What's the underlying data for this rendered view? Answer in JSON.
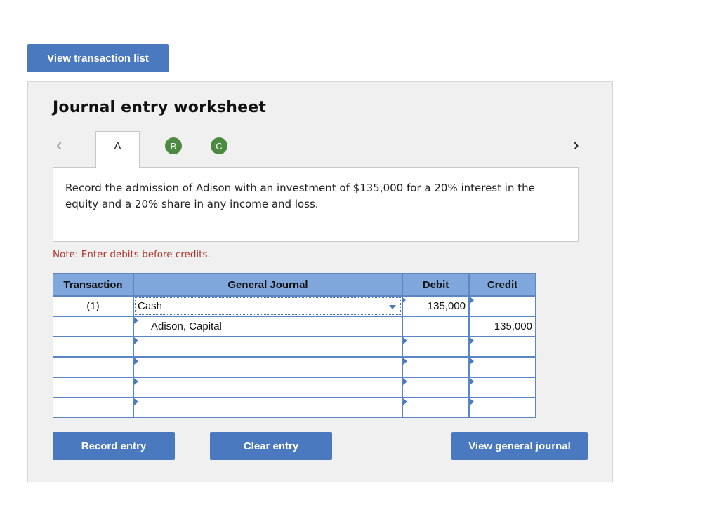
{
  "top_button": "View transaction list",
  "worksheet": {
    "title": "Journal entry worksheet",
    "tabs": [
      "A",
      "B",
      "C"
    ],
    "description": "Record the admission of Adison with an investment of $135,000 for a 20% interest in the equity and a 20% share in any income and loss.",
    "note": "Note: Enter debits before credits."
  },
  "journal": {
    "headers": {
      "transaction": "Transaction",
      "account": "General Journal",
      "debit": "Debit",
      "credit": "Credit"
    },
    "rows": [
      {
        "transaction": "(1)",
        "account": "Cash",
        "debit": "135,000",
        "credit": ""
      },
      {
        "transaction": "",
        "account": "Adison, Capital",
        "debit": "",
        "credit": "135,000"
      },
      {
        "transaction": "",
        "account": "",
        "debit": "",
        "credit": ""
      },
      {
        "transaction": "",
        "account": "",
        "debit": "",
        "credit": ""
      },
      {
        "transaction": "",
        "account": "",
        "debit": "",
        "credit": ""
      },
      {
        "transaction": "",
        "account": "",
        "debit": "",
        "credit": ""
      }
    ]
  },
  "buttons": {
    "record": "Record entry",
    "clear": "Clear entry",
    "view_general_journal": "View general journal"
  },
  "icons": {
    "prev": "chevron-left-icon",
    "next": "chevron-right-icon",
    "dropdown": "dropdown-arrow-icon"
  },
  "colors": {
    "button": "#4a79bf",
    "header": "#7fa7dc",
    "tab_circle": "#4b8a40",
    "note": "#b0352b"
  }
}
